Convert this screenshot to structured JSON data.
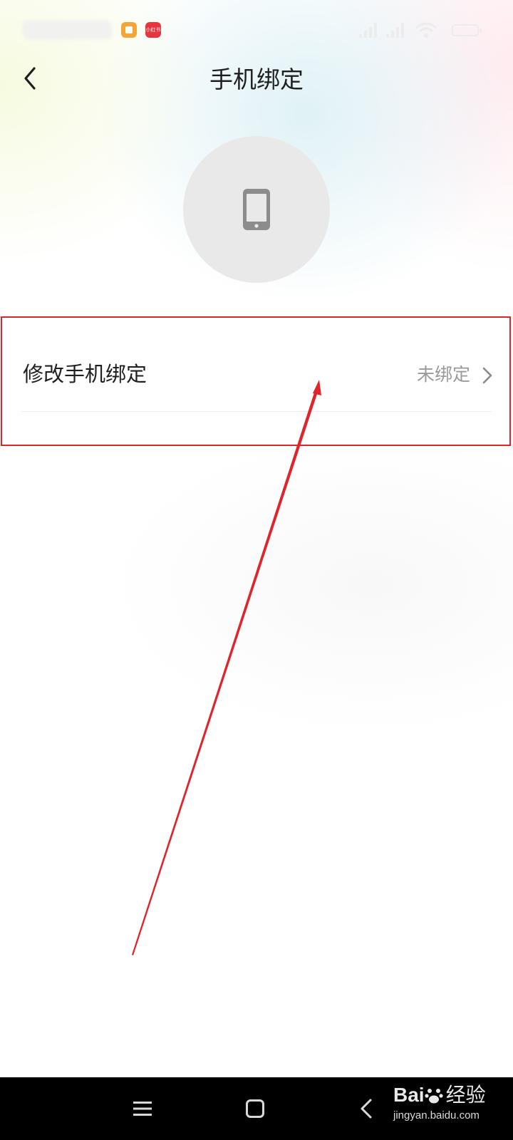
{
  "status_bar": {
    "app_icons": [
      "note-app-icon",
      "xiaohongshu-app-icon"
    ],
    "red_app_text": "小红书",
    "indicators": [
      "signal-icon",
      "signal-icon",
      "wifi-icon",
      "battery-icon"
    ]
  },
  "header": {
    "back_icon": "chevron-left-icon",
    "title": "手机绑定"
  },
  "avatar": {
    "icon": "smartphone-icon",
    "background_color": "#e9e9e9",
    "icon_color": "#8c8c8c"
  },
  "settings": {
    "items": [
      {
        "label": "修改手机绑定",
        "value": "未绑定",
        "icon": "chevron-right-icon"
      }
    ]
  },
  "annotation": {
    "box_color": "#e0242b",
    "arrow_color": "#e0242b"
  },
  "system_nav": {
    "buttons": [
      "menu-icon",
      "home-icon",
      "back-icon"
    ]
  },
  "watermark": {
    "brand": "Bai",
    "brand_cn": "经验",
    "url": "jingyan.baidu.com"
  }
}
